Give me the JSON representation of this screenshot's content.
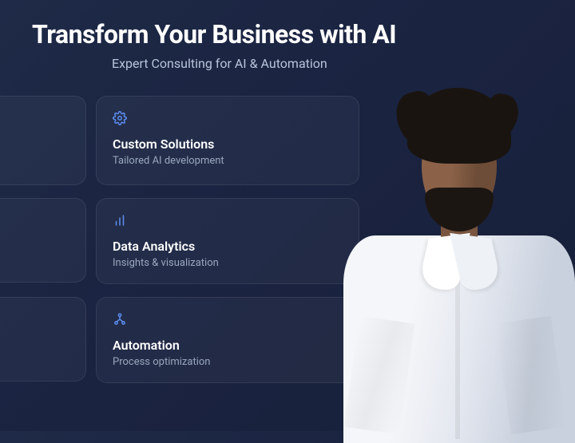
{
  "header": {
    "title": "Transform Your Business with AI",
    "subtitle": "Expert Consulting for AI & Automation"
  },
  "cards": [
    {
      "icon": "settings-icon",
      "title": "Custom Solutions",
      "desc": "Tailored AI development"
    },
    {
      "icon": "bar-chart-icon",
      "title": "Data Analytics",
      "desc": "Insights & visualization"
    },
    {
      "icon": "workflow-icon",
      "title": "Automation",
      "desc": "Process optimization"
    }
  ],
  "accent_color": "#5b8def"
}
